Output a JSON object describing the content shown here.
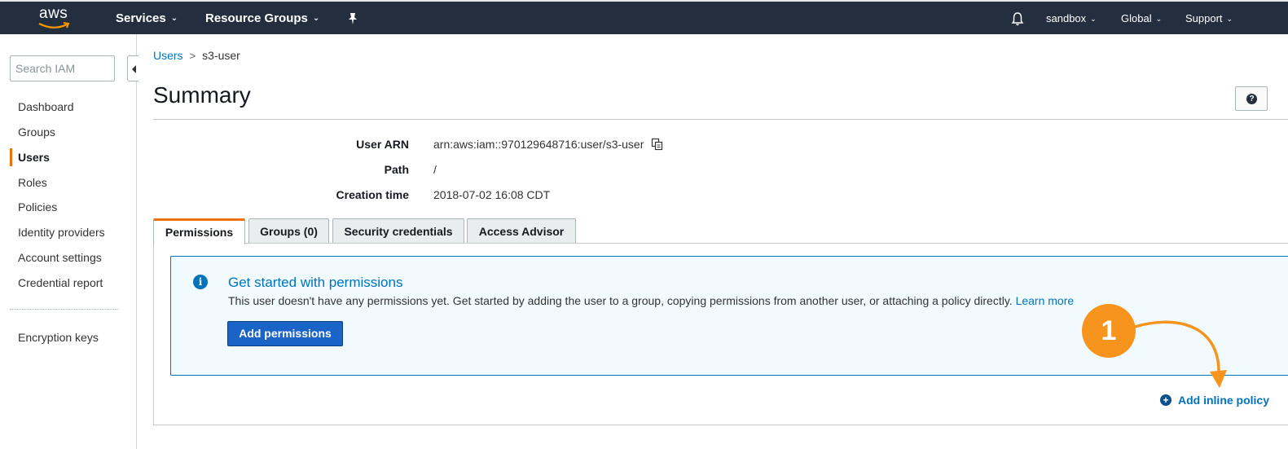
{
  "topnav": {
    "logo_text": "aws",
    "services": "Services",
    "resource_groups": "Resource Groups",
    "account": "sandbox",
    "region": "Global",
    "support": "Support",
    "caret": "⌄"
  },
  "sidebar": {
    "search_placeholder": "Search IAM",
    "items": [
      {
        "label": "Dashboard"
      },
      {
        "label": "Groups"
      },
      {
        "label": "Users"
      },
      {
        "label": "Roles"
      },
      {
        "label": "Policies"
      },
      {
        "label": "Identity providers"
      },
      {
        "label": "Account settings"
      },
      {
        "label": "Credential report"
      },
      {
        "label": "Encryption keys"
      }
    ]
  },
  "breadcrumb": {
    "parent": "Users",
    "separator": ">",
    "current": "s3-user"
  },
  "page": {
    "title": "Summary",
    "help_glyph": "?"
  },
  "details": [
    {
      "label": "User ARN",
      "value": "arn:aws:iam::970129648716:user/s3-user"
    },
    {
      "label": "Path",
      "value": "/"
    },
    {
      "label": "Creation time",
      "value": "2018-07-02 16:08 CDT"
    }
  ],
  "tabs": [
    {
      "label": "Permissions"
    },
    {
      "label": "Groups (0)"
    },
    {
      "label": "Security credentials"
    },
    {
      "label": "Access Advisor"
    }
  ],
  "alert": {
    "icon_glyph": "i",
    "title": "Get started with permissions",
    "text": "This user doesn't have any permissions yet. Get started by adding the user to a group, copying permissions from another user, or attaching a policy directly. ",
    "learn_more": "Learn more",
    "button_label": "Add permissions"
  },
  "annotation": {
    "step_number": "1",
    "color": "#f7941d"
  },
  "inline_policy": {
    "plus_glyph": "+",
    "label": "Add inline policy"
  },
  "colors": {
    "nav_bg": "#232f3e",
    "accent": "#ec7211",
    "link": "#0073bb",
    "primary_button": "#1a64c7"
  }
}
